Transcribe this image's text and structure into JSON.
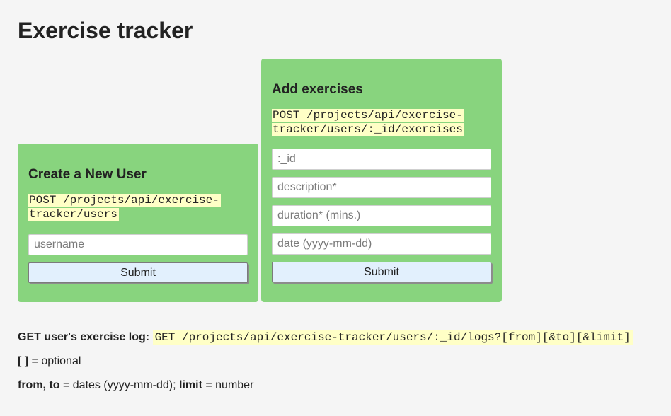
{
  "page": {
    "title": "Exercise tracker"
  },
  "new_user": {
    "heading": "Create a New User",
    "endpoint": "POST /projects/api/exercise-tracker/users",
    "username_placeholder": "username",
    "submit_label": "Submit"
  },
  "add_exercises": {
    "heading": "Add exercises",
    "endpoint": "POST /projects/api/exercise-tracker/users/:_id/exercises",
    "id_placeholder": ":_id",
    "description_placeholder": "description*",
    "duration_placeholder": "duration* (mins.)",
    "date_placeholder": "date (yyyy-mm-dd)",
    "submit_label": "Submit"
  },
  "log_info": {
    "label": "GET user's exercise log:",
    "endpoint": "GET /projects/api/exercise-tracker/users/:_id/logs?[from][&to][&limit]",
    "optional_symbol": "[ ]",
    "optional_text": " = optional",
    "params_bold_1": "from, to",
    "params_text_1": " = dates (yyyy-mm-dd); ",
    "params_bold_2": "limit",
    "params_text_2": " = number"
  },
  "colors": {
    "card_bg": "#88d47e",
    "code_bg": "#ffffc6",
    "button_bg": "#e2f0fd",
    "page_bg": "#f5f5f5"
  }
}
